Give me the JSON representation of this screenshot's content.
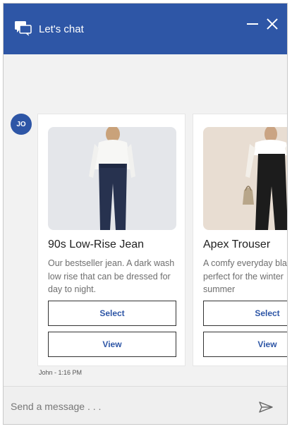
{
  "header": {
    "title": "Let's chat"
  },
  "message": {
    "avatar_initials": "JO",
    "timestamp": "John - 1:16 PM"
  },
  "products": [
    {
      "title": "90s Low-Rise Jean",
      "description": [
        "Our bestseller jean. A dark wash",
        "low rise that can be dressed for",
        "day to night."
      ],
      "select_label": "Select",
      "view_label": "View"
    },
    {
      "title": "Apex Trouser",
      "description": [
        "A comfy everyday bla",
        "perfect for the winter",
        "summer"
      ],
      "select_label": "Select",
      "view_label": "View"
    }
  ],
  "composer": {
    "placeholder": "Send a message . . ."
  },
  "colors": {
    "accent": "#2e56a6",
    "background": "#f2f2f2"
  },
  "icons": [
    "chat-bubbles-icon",
    "minimize-icon",
    "close-icon",
    "send-icon"
  ]
}
